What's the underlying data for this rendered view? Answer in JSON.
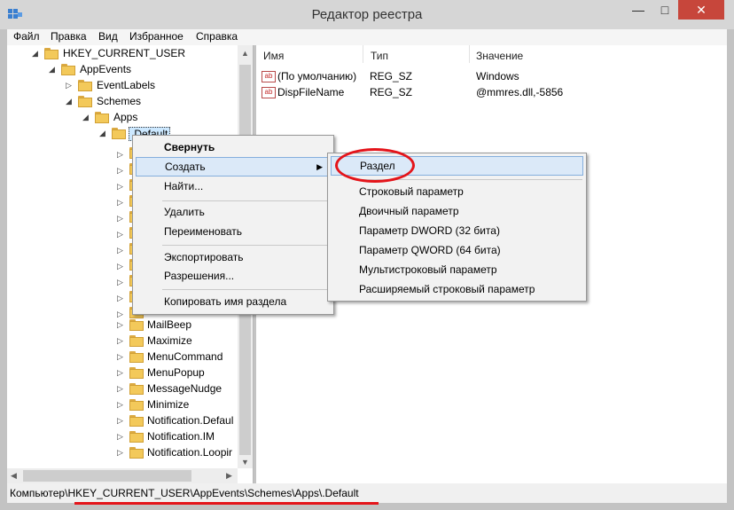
{
  "window": {
    "title": "Редактор реестра",
    "controls": {
      "minimize": "—",
      "maximize": "□",
      "close": "✕"
    }
  },
  "menu": [
    "Файл",
    "Правка",
    "Вид",
    "Избранное",
    "Справка"
  ],
  "tree": {
    "nodes": [
      {
        "label": "HKEY_CURRENT_USER",
        "twisty": "◢"
      },
      {
        "label": "AppEvents",
        "twisty": "◢"
      },
      {
        "label": "EventLabels",
        "twisty": "▷"
      },
      {
        "label": "Schemes",
        "twisty": "◢"
      },
      {
        "label": "Apps",
        "twisty": "◢"
      },
      {
        "label": ".Default",
        "twisty": "◢"
      },
      {
        "label": "MailBeep",
        "twisty": "▷"
      },
      {
        "label": "Maximize",
        "twisty": "▷"
      },
      {
        "label": "MenuCommand",
        "twisty": "▷"
      },
      {
        "label": "MenuPopup",
        "twisty": "▷"
      },
      {
        "label": "MessageNudge",
        "twisty": "▷"
      },
      {
        "label": "Minimize",
        "twisty": "▷"
      },
      {
        "label": "Notification.Defaul",
        "twisty": "▷"
      },
      {
        "label": "Notification.IM",
        "twisty": "▷"
      },
      {
        "label": "Notification.Loopir",
        "twisty": "▷"
      }
    ],
    "hidden_twisty": "▷"
  },
  "list": {
    "columns": [
      "Имя",
      "Тип",
      "Значение"
    ],
    "rows": [
      {
        "name": "(По умолчанию)",
        "type": "REG_SZ",
        "value": "Windows"
      },
      {
        "name": "DispFileName",
        "type": "REG_SZ",
        "value": "@mmres.dll,-5856"
      }
    ],
    "icon_text": "ab"
  },
  "context_menu": {
    "items": [
      "Свернуть",
      "Создать",
      "Найти...",
      "Удалить",
      "Переименовать",
      "Экспортировать",
      "Разрешения...",
      "Копировать имя раздела"
    ],
    "submenu_arrow": "▶"
  },
  "submenu": {
    "items": [
      "Раздел",
      "Строковый параметр",
      "Двоичный параметр",
      "Параметр DWORD (32 бита)",
      "Параметр QWORD (64 бита)",
      "Мультистроковый параметр",
      "Расширяемый строковый параметр"
    ]
  },
  "scroll_arrows": {
    "up": "▲",
    "down": "▼",
    "left": "◀",
    "right": "▶"
  },
  "status": {
    "path": "Компьютер\\HKEY_CURRENT_USER\\AppEvents\\Schemes\\Apps\\.Default"
  },
  "colors": {
    "highlight": "#e4141a",
    "selection": "#cce8ff",
    "menu_hover": "#dbe9f8"
  }
}
